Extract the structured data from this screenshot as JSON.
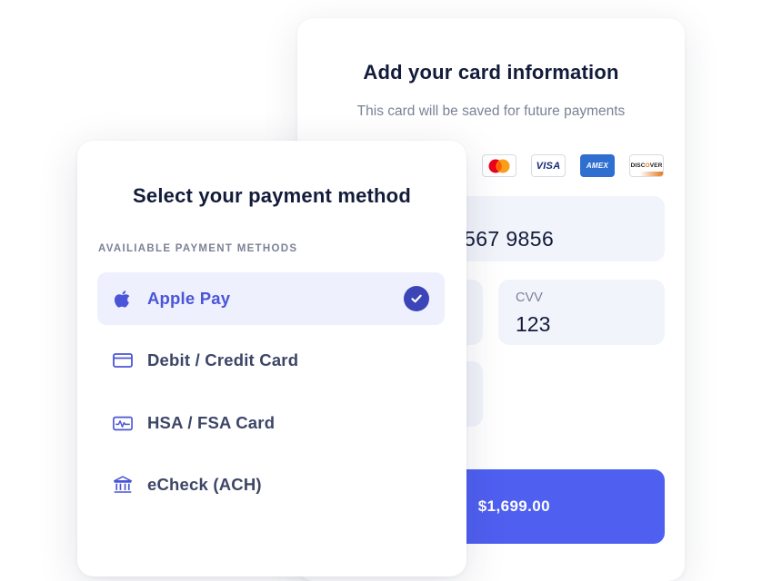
{
  "card_form": {
    "title": "Add your card information",
    "subtitle": "This card will be saved for future payments",
    "brands": [
      {
        "name": "mastercard-logo"
      },
      {
        "name": "visa-logo",
        "text": "VISA"
      },
      {
        "name": "amex-logo",
        "text": "AMEX"
      },
      {
        "name": "discover-logo",
        "text": "DISCOVER"
      }
    ],
    "card_number_visible": "567 9856",
    "cvv_label": "CVV",
    "cvv_value": "123",
    "pay_button_label": "$1,699.00"
  },
  "payment_methods": {
    "title": "Select your payment method",
    "section_label": "AVAILIABLE PAYMENT METHODS",
    "items": [
      {
        "label": "Apple Pay",
        "icon": "apple-icon",
        "selected": true
      },
      {
        "label": "Debit / Credit Card",
        "icon": "credit-card-icon",
        "selected": false
      },
      {
        "label": "HSA / FSA Card",
        "icon": "health-card-icon",
        "selected": false
      },
      {
        "label": "eCheck (ACH)",
        "icon": "bank-icon",
        "selected": false
      }
    ]
  },
  "colors": {
    "accent": "#4f5ff0",
    "check": "#3c45b8",
    "selected_bg": "#eef0fe",
    "field_bg": "#f2f4fb",
    "icon": "#4a55d8"
  }
}
